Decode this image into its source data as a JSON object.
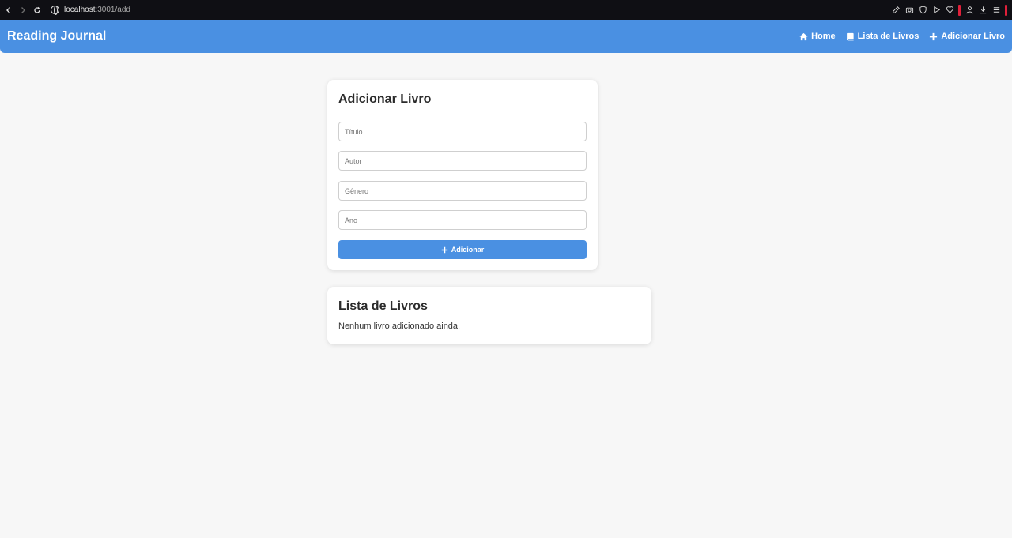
{
  "browser": {
    "url_host": "localhost",
    "url_path": ":3001/add"
  },
  "navbar": {
    "brand": "Reading Journal",
    "links": [
      {
        "label": "Home",
        "icon": "home-icon"
      },
      {
        "label": "Lista de Livros",
        "icon": "book-icon"
      },
      {
        "label": "Adicionar Livro",
        "icon": "plus-icon"
      }
    ],
    "color": "#4a90e2"
  },
  "form": {
    "title": "Adicionar Livro",
    "fields": {
      "titulo": {
        "placeholder": "Título",
        "value": ""
      },
      "autor": {
        "placeholder": "Autor",
        "value": ""
      },
      "genero": {
        "placeholder": "Gênero",
        "value": ""
      },
      "ano": {
        "placeholder": "Ano",
        "value": ""
      }
    },
    "submit_label": "Adicionar"
  },
  "book_list": {
    "title": "Lista de Livros",
    "empty_message": "Nenhum livro adicionado ainda."
  }
}
